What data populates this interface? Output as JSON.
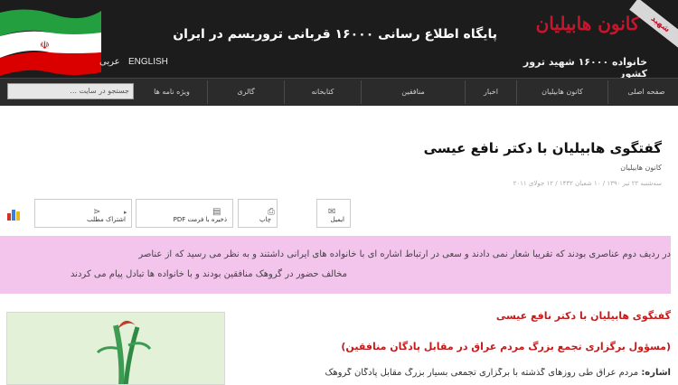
{
  "site": {
    "logo": "کانون هابیلیان",
    "logo_subtitle": "خانواده ۱۶۰۰۰ شهید ترور کشور",
    "tagline": "پایگاه اطلاع رسانی ۱۶۰۰۰ قربانی تروریسم در ایران",
    "ribbon": "شهید",
    "lang_en": "ENGLISH",
    "lang_ar": "عربی"
  },
  "nav": {
    "items": [
      "صفحه اصلی",
      "کانون هابیلیان",
      "اخبار",
      "منافقین",
      "کتابخانه",
      "گالری",
      "ویژه نامه ها"
    ],
    "search_placeholder": "جستجو در سایت ..."
  },
  "article": {
    "title": "گفتگوی هابیلیان با دکتر نافع عیسی",
    "author": "کانون هابیلیان",
    "date": "سه‌شنبه ۲۲ تیر ۱۳۹۰ / ۱۰ شعبان ۱۴۳۲ / ۱۲ جولای ۲۰۱۱"
  },
  "toolbar": {
    "email": "ایمیل",
    "print": "چاپ",
    "pdf": "ذخیره با فرمت PDF",
    "share": "اشتراک مطلب"
  },
  "quote": {
    "line1": "در ردیف دوم عناصری بودند که تقریبا شعار نمی دادند و سعی در ارتباط اشاره ای با خانواده های ایرانی داشتند و به نظر می رسید که از عناصر",
    "line2": "مخالف حضور در گروهک منافقین بودند و با خانواده ها تبادل پیام می کردند"
  },
  "body": {
    "heading1": "گفتگوی هابیلیان با دکتر نافع عیسی",
    "heading2": "(مسؤول برگزاری تجمع بزرگ مردم عراق در مقابل پادگان منافقین)",
    "label": "اشاره:",
    "text": "مردم عراق طی روزهای گذشته با برگزاری تجمعی بسیار بزرگ مقابل پادگان گروهک"
  },
  "colors": {
    "header_bg": "#1c1c1c",
    "logo_red": "#c8152b",
    "quote_bg": "#f3c4ec",
    "heading_red": "#c41a1a"
  }
}
